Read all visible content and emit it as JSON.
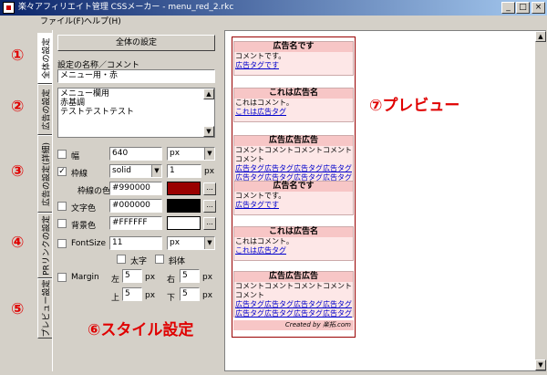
{
  "titlebar": {
    "title": "楽々アフィリエイト管理 CSSメーカー - menu_red_2.rkc",
    "btn_min": "_",
    "btn_max": "□",
    "btn_close": "×"
  },
  "menu": {
    "file": "ファイル(F)",
    "help": "ヘルプ(H)"
  },
  "tabs": {
    "overall": "全体の設定",
    "ad": "広告の設定",
    "detail": "広告の設定(詳細)",
    "pr": "PRリンクの設定",
    "preview": "プレビュー設定"
  },
  "numbers": {
    "n1": "①",
    "n2": "②",
    "n3": "③",
    "n4": "④",
    "n5": "⑤",
    "n6": "⑥スタイル設定",
    "n7": "⑦プレビュー"
  },
  "panel": {
    "overall_button": "全体の設定",
    "name_label": "設定の名称／コメント",
    "name_value": "メニュー用・赤",
    "comment_lines": [
      "メニュー欄用",
      "赤基調",
      "テストテストテスト"
    ],
    "width": {
      "label": "幅",
      "value": "640",
      "unit": "px"
    },
    "border": {
      "label": "枠線",
      "style": "solid",
      "size": "1",
      "unit": "px"
    },
    "border_color": {
      "label": "枠線の色",
      "value": "#990000",
      "swatch": "#990000"
    },
    "text_color": {
      "label": "文字色",
      "value": "#000000",
      "swatch": "#000000"
    },
    "bg_color": {
      "label": "背景色",
      "value": "#FFFFFF",
      "swatch": "#FFFFFF"
    },
    "font": {
      "label": "FontSize",
      "value": "11",
      "unit": "px",
      "bold": "太字",
      "italic": "斜体"
    },
    "margin": {
      "label": "Margin",
      "left": "左",
      "left_val": "5",
      "right": "右",
      "right_val": "5",
      "top": "上",
      "top_val": "5",
      "bottom": "下",
      "bottom_val": "5",
      "unit": "px"
    },
    "more": "..."
  },
  "preview": {
    "ads": [
      {
        "title": "広告名です",
        "lines": [
          "コメントです。"
        ],
        "links": [
          "広告タグです"
        ]
      },
      {
        "title": "これは広告名",
        "lines": [
          "これはコメント。"
        ],
        "links": [
          "これは広告タグ"
        ]
      },
      {
        "title": "広告広告広告",
        "lines": [
          "コメントコメントコメントコメント",
          "コメント"
        ],
        "links": [
          "広告タグ広告タグ広告タグ広告タグ",
          "広告タグ広告タグ広告タグ広告タグ"
        ]
      },
      {
        "title": "広告名です",
        "lines": [
          "コメントです。"
        ],
        "links": [
          "広告タグです"
        ]
      },
      {
        "title": "これは広告名",
        "lines": [
          "これはコメント。"
        ],
        "links": [
          "これは広告タグ"
        ]
      },
      {
        "title": "広告広告広告",
        "lines": [
          "コメントコメントコメントコメント",
          "コメント"
        ],
        "links": [
          "広告タグ広告タグ広告タグ広告タグ",
          "広告タグ広告タグ広告タグ広告タグ"
        ]
      }
    ],
    "credit": "Created by 楽拓.com"
  },
  "colors": {
    "accent": "#e00000",
    "header_bg": "#f7c6c6",
    "ad_bg": "#fde7e7"
  }
}
